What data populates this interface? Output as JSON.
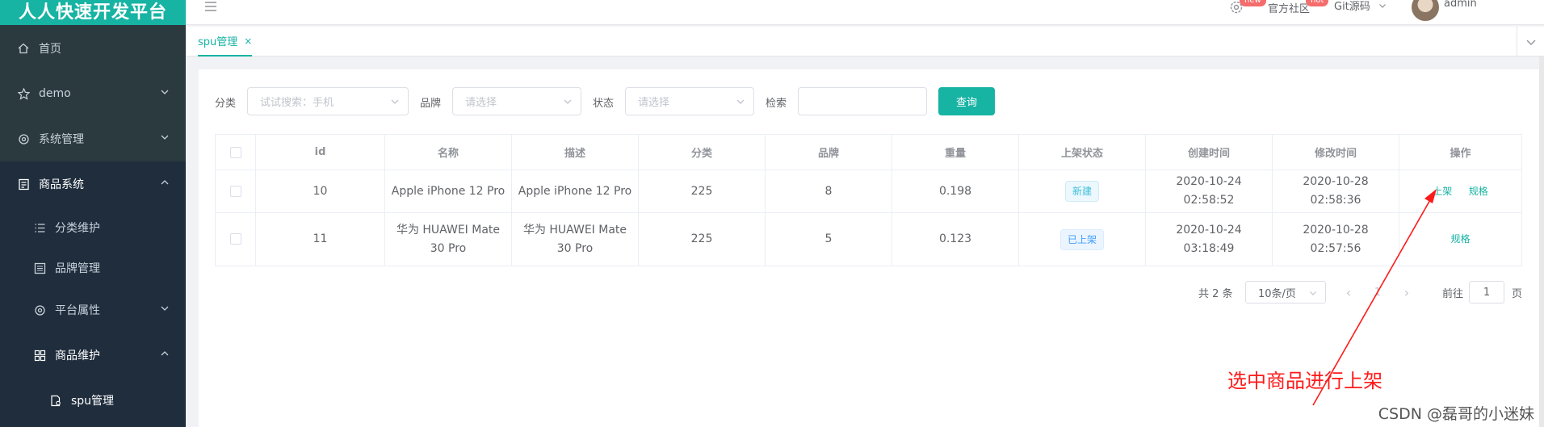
{
  "app": {
    "brand": "人人快速开发平台"
  },
  "sidebar": {
    "items": [
      {
        "label": "首页"
      },
      {
        "label": "demo"
      },
      {
        "label": "系统管理"
      },
      {
        "label": "商品系统"
      },
      {
        "label": "分类维护"
      },
      {
        "label": "品牌管理"
      },
      {
        "label": "平台属性"
      },
      {
        "label": "商品维护"
      },
      {
        "label": "spu管理"
      }
    ]
  },
  "header": {
    "settings_badge": "new",
    "community_label": "官方社区",
    "community_badge": "hot",
    "git_label": "Git源码",
    "user_name": "admin"
  },
  "tabs": [
    {
      "label": "spu管理",
      "close": "×"
    }
  ],
  "filters": {
    "category_label": "分类",
    "category_placeholder": "试试搜索：手机",
    "brand_label": "品牌",
    "brand_placeholder": "请选择",
    "status_label": "状态",
    "status_placeholder": "请选择",
    "search_label": "检索",
    "search_value": "",
    "query_button": "查询"
  },
  "table": {
    "columns": [
      "id",
      "名称",
      "描述",
      "分类",
      "品牌",
      "重量",
      "上架状态",
      "创建时间",
      "修改时间",
      "操作"
    ],
    "rows": [
      {
        "id": "10",
        "name": "Apple iPhone 12 Pro",
        "desc": "Apple iPhone 12 Pro",
        "category": "225",
        "brand": "8",
        "weight": "0.198",
        "status": "新建",
        "created": "2020-10-24 02:58:52",
        "modified": "2020-10-28 02:58:36",
        "action_up": "上架",
        "action_spec": "规格"
      },
      {
        "id": "11",
        "name": "华为 HUAWEI Mate 30 Pro",
        "desc": "华为 HUAWEI Mate 30 Pro",
        "category": "225",
        "brand": "5",
        "weight": "0.123",
        "status": "已上架",
        "created": "2020-10-24 03:18:49",
        "modified": "2020-10-28 02:57:56",
        "action_spec": "规格"
      }
    ]
  },
  "pagination": {
    "total_text": "共 2 条",
    "page_size": "10条/页",
    "current_page": "1",
    "goto_label": "前往",
    "goto_value": "1",
    "page_unit": "页"
  },
  "annotation": {
    "text": "选中商品进行上架",
    "color": "#ff1a1a"
  },
  "watermark": "CSDN @磊哥的小迷妹",
  "colors": {
    "accent": "#17b3a3",
    "sidebar": "#2b3a3f",
    "sidebar_sub": "#1f2d3d"
  }
}
